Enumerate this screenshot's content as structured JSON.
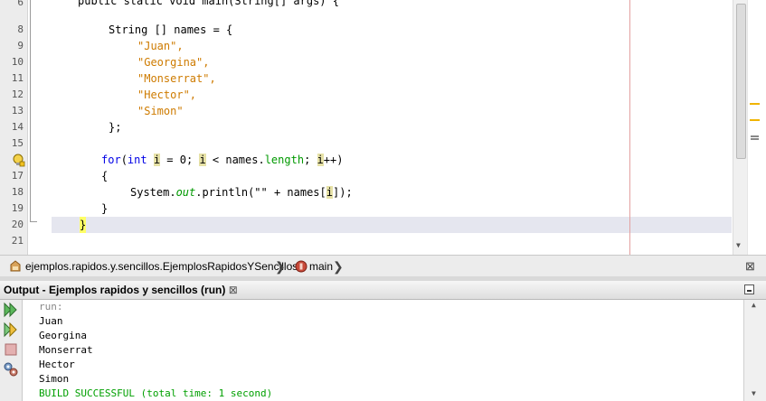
{
  "editor": {
    "line_numbers": [
      "8",
      "9",
      "10",
      "11",
      "12",
      "13",
      "14",
      "15",
      "",
      "17",
      "18",
      "19",
      "20",
      "21"
    ],
    "partial_top_line": "public static void main(String[] args) {",
    "code": {
      "l8": "String [] names = {",
      "l9": "\"Juan\",",
      "l10": "\"Georgina\",",
      "l11": "\"Monserrat\",",
      "l12": "\"Hector\",",
      "l13": "\"Simon\"",
      "l14": "};",
      "l16_for": "for",
      "l16_open": "(",
      "l16_int": "int",
      "l16_i1": "i",
      "l16_mid": " = 0; ",
      "l16_i2": "i",
      "l16_mid2": " < names.",
      "l16_length": "length",
      "l16_mid3": "; ",
      "l16_i3": "i",
      "l16_end": "++)",
      "l17": "{",
      "l18_a": "System.",
      "l18_out": "out",
      "l18_b": ".println(\"\" + names[",
      "l18_i": "i",
      "l18_c": "]);",
      "l19": "}",
      "l20": "}"
    }
  },
  "breadcrumb": {
    "class_path": "ejemplos.rapidos.y.sencillos.EjemplosRapidosYSencillos",
    "method": "main",
    "close_glyph": "⊠"
  },
  "output": {
    "title": "Output - Ejemplos rapidos y sencillos (run)",
    "close_glyph": "⊠",
    "lines": [
      "run:",
      "Juan",
      "Georgina",
      "Monserrat",
      "Hector",
      "Simon",
      "BUILD SUCCESSFUL (total time: 1 second)"
    ],
    "colors": {
      "run": "#888888",
      "text": "#000000",
      "build": "#00a000"
    }
  },
  "icons": [
    "bulb-hint-icon",
    "class-icon",
    "method-icon",
    "rerun-icon",
    "rerun-with-options-icon",
    "stop-icon",
    "settings-icon",
    "close-icon",
    "minimize-icon",
    "scroll-up-icon",
    "scroll-down-icon"
  ]
}
